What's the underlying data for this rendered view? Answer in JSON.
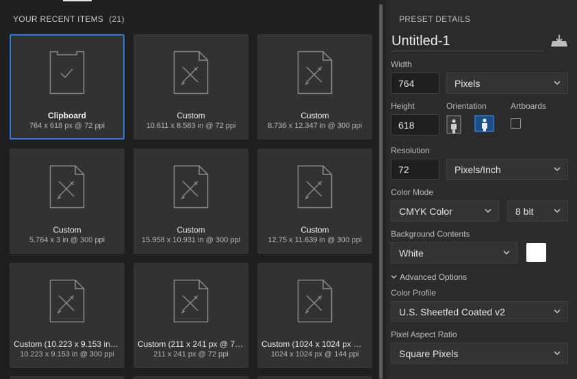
{
  "recent": {
    "title": "YOUR RECENT ITEMS",
    "count": "(21)",
    "items": [
      {
        "name": "Clipboard",
        "dims": "764 x 618 px @ 72 ppi",
        "icon": "clipboard-icon",
        "selected": true
      },
      {
        "name": "Custom",
        "dims": "10.611 x 8.583 in @ 72 ppi",
        "icon": "document-icon"
      },
      {
        "name": "Custom",
        "dims": "8.736 x 12.347 in @ 300 ppi",
        "icon": "document-icon"
      },
      {
        "name": "Custom",
        "dims": "5.764 x 3 in @ 300 ppi",
        "icon": "document-icon"
      },
      {
        "name": "Custom",
        "dims": "15.958 x 10.931 in @ 300 ppi",
        "icon": "document-icon"
      },
      {
        "name": "Custom",
        "dims": "12.75 x 11.639 in @ 300 ppi",
        "icon": "document-icon"
      },
      {
        "name": "Custom (10.223 x 9.153 in @ ...",
        "dims": "10.223 x 9.153 in @ 300 ppi",
        "icon": "document-icon"
      },
      {
        "name": "Custom (211 x 241 px @ 72 ppi)",
        "dims": "211 x 241 px @ 72 ppi",
        "icon": "document-icon"
      },
      {
        "name": "Custom (1024 x 1024 px @ 14...",
        "dims": "1024 x 1024 px @ 144 ppi",
        "icon": "document-icon"
      }
    ]
  },
  "preset": {
    "title": "PRESET DETAILS",
    "doc_name": "Untitled-1",
    "width_label": "Width",
    "width_value": "764",
    "width_unit": "Pixels",
    "height_label": "Height",
    "height_value": "618",
    "orientation_label": "Orientation",
    "artboards_label": "Artboards",
    "resolution_label": "Resolution",
    "resolution_value": "72",
    "resolution_unit": "Pixels/Inch",
    "color_mode_label": "Color Mode",
    "color_mode_value": "CMYK Color",
    "bit_depth_value": "8 bit",
    "background_label": "Background Contents",
    "background_value": "White",
    "background_color": "#ffffff",
    "advanced_label": "Advanced Options",
    "color_profile_label": "Color Profile",
    "color_profile_value": "U.S. Sheetfed Coated v2",
    "pixel_aspect_label": "Pixel Aspect Ratio",
    "pixel_aspect_value": "Square Pixels"
  },
  "colors": {
    "accent": "#2d7ad6",
    "card_bg": "#323232",
    "panel_bg": "#2b2b2b"
  }
}
